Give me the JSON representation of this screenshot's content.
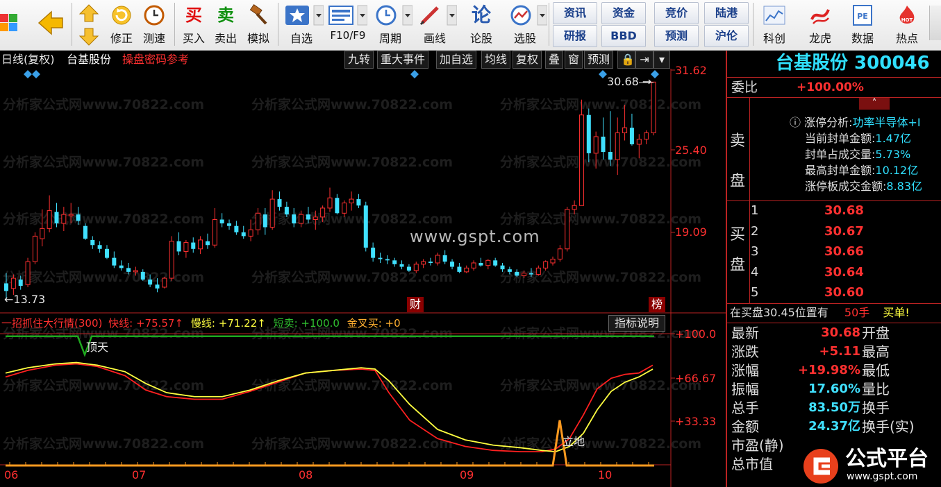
{
  "toolbar": {
    "buttons": [
      {
        "label": "修正",
        "icon": "refresh-icon"
      },
      {
        "label": "测速",
        "icon": "clock-icon"
      },
      {
        "label": "买入",
        "icon": "buy-icon"
      },
      {
        "label": "卖出",
        "icon": "sell-icon"
      },
      {
        "label": "模拟",
        "icon": "gavel-icon"
      },
      {
        "label": "自选",
        "icon": "star-icon"
      },
      {
        "label": "F10/F9",
        "icon": "f10-icon"
      },
      {
        "label": "周期",
        "icon": "period-icon"
      },
      {
        "label": "画线",
        "icon": "pen-icon"
      },
      {
        "label": "论股",
        "icon": "discuss-icon"
      },
      {
        "label": "选股",
        "icon": "select-stock-icon"
      },
      {
        "label": "科创",
        "icon": "kechuang-icon"
      },
      {
        "label": "龙虎",
        "icon": "dragon-icon"
      },
      {
        "label": "数据",
        "icon": "pe-icon"
      },
      {
        "label": "热点",
        "icon": "hot-icon"
      }
    ],
    "pairs": [
      {
        "top": "资讯",
        "bottom": "研报"
      },
      {
        "top": "资金",
        "bottom": "BBD"
      },
      {
        "top": "竞价",
        "bottom": "预测"
      },
      {
        "top": "陆港",
        "bottom": "沪伦"
      }
    ]
  },
  "chart": {
    "period_label": "日线(复权)",
    "stock_name": "台基股份",
    "alert_text": "操盘密码参考",
    "tabs": [
      "九转",
      "重大事件",
      "加自选",
      "均线",
      "复权",
      "叠",
      "窗",
      "预测"
    ],
    "price_axis": [
      "31.62",
      "25.40",
      "19.09"
    ],
    "max_label": "30.68",
    "min_label": "13.73",
    "marker_cai": "财",
    "marker_bang": "榜",
    "watermark": "分析家公式网www.70822.com",
    "center_watermark": "www.gspt.com",
    "months": [
      "06",
      "07",
      "08",
      "09",
      "10"
    ]
  },
  "indicator": {
    "name": "一招抓住大行情(300)",
    "fast_label": "快线:",
    "fast_value": "+75.57↑",
    "slow_label": "慢线:",
    "slow_value": "+71.22↑",
    "short_label": "短卖:",
    "short_value": "+100.0",
    "cross_label": "金叉买:",
    "cross_value": "+0",
    "explain_button": "指标说明",
    "axis": [
      "+100.0",
      "+66.67",
      "+33.33"
    ],
    "top_label": "顶天",
    "bottom_label": "立地",
    "fast_color": "#ff2020",
    "slow_color": "#ffff40"
  },
  "quote": {
    "title": "台基股份 300046",
    "weibi_label": "委比",
    "weibi_value": "+100.00%",
    "sell_label": [
      "卖",
      "盘"
    ],
    "limit_title": "涨停分析:",
    "limit_sector": "功率半导体+I",
    "limit_lines": [
      {
        "label": "当前封单金额:",
        "value": "1.47亿"
      },
      {
        "label": "封单占成交量:",
        "value": "5.73%"
      },
      {
        "label": "最高封单金额:",
        "value": "10.12亿"
      },
      {
        "label": "涨停板成交金额:",
        "value": "8.83亿"
      }
    ],
    "buy_label": [
      "买",
      "盘"
    ],
    "bids": [
      {
        "level": "1",
        "price": "30.68"
      },
      {
        "level": "2",
        "price": "30.67"
      },
      {
        "level": "3",
        "price": "30.66"
      },
      {
        "level": "4",
        "price": "30.64"
      },
      {
        "level": "5",
        "price": "30.60"
      }
    ],
    "alert_prefix": "在买盘30.45位置有",
    "alert_qty": "50手",
    "alert_suffix": "买单!",
    "stats": [
      {
        "label": "最新",
        "value": "30.68",
        "label2": "开盘",
        "color": "#ff3030"
      },
      {
        "label": "涨跌",
        "value": "+5.11",
        "label2": "最高",
        "color": "#ff3030"
      },
      {
        "label": "涨幅",
        "value": "+19.98%",
        "label2": "最低",
        "color": "#ff3030"
      },
      {
        "label": "振幅",
        "value": "17.60%",
        "label2": "量比",
        "color": "#40e0ff"
      },
      {
        "label": "总手",
        "value": "83.50万",
        "label2": "换手",
        "color": "#40e0ff"
      },
      {
        "label": "金额",
        "value": "24.37亿",
        "label2": "换手(实)",
        "color": "#40e0ff"
      },
      {
        "label": "市盈(静)",
        "value": "",
        "label2": "",
        "color": "#40e0ff"
      },
      {
        "label": "总市值",
        "value": "",
        "label2": "",
        "color": "#40e0ff"
      }
    ],
    "logo_text": "公式平台",
    "logo_url": "www.gspt.com"
  },
  "candles": [
    [
      14.9,
      15.7,
      13.73,
      14.3
    ],
    [
      14.5,
      15.6,
      14.0,
      15.3
    ],
    [
      15.2,
      15.5,
      14.4,
      14.7
    ],
    [
      14.8,
      16.9,
      14.6,
      16.6
    ],
    [
      16.6,
      18.9,
      16.4,
      18.6
    ],
    [
      18.4,
      20.7,
      17.8,
      19.2
    ],
    [
      19.2,
      21.8,
      18.9,
      20.6
    ],
    [
      20.5,
      21.2,
      19.3,
      19.6
    ],
    [
      19.6,
      20.9,
      19.0,
      20.3
    ],
    [
      20.2,
      21.2,
      19.6,
      20.3
    ],
    [
      20.3,
      20.9,
      19.5,
      19.8
    ],
    [
      19.4,
      19.6,
      18.3,
      18.4
    ],
    [
      18.3,
      18.6,
      17.6,
      17.9
    ],
    [
      17.9,
      18.2,
      17.3,
      17.6
    ],
    [
      17.6,
      17.9,
      16.8,
      16.9
    ],
    [
      16.9,
      17.4,
      16.1,
      16.3
    ],
    [
      16.3,
      16.7,
      15.9,
      16.1
    ],
    [
      16.1,
      16.5,
      15.6,
      15.8
    ],
    [
      15.8,
      16.2,
      15.5,
      15.9
    ],
    [
      15.8,
      16.0,
      15.1,
      15.2
    ],
    [
      15.2,
      15.6,
      14.6,
      14.8
    ],
    [
      14.8,
      15.3,
      14.2,
      14.5
    ],
    [
      14.6,
      15.4,
      14.5,
      15.3
    ],
    [
      15.3,
      18.6,
      15.1,
      18.2
    ],
    [
      18.2,
      18.9,
      17.1,
      17.4
    ],
    [
      17.4,
      18.3,
      16.9,
      18.1
    ],
    [
      18.1,
      18.5,
      17.3,
      17.6
    ],
    [
      17.6,
      18.6,
      17.2,
      18.3
    ],
    [
      18.2,
      18.8,
      17.6,
      17.9
    ],
    [
      17.9,
      20.8,
      17.7,
      19.9
    ],
    [
      19.9,
      20.4,
      19.3,
      19.6
    ],
    [
      19.6,
      19.9,
      19.1,
      19.4
    ],
    [
      19.4,
      19.8,
      18.7,
      18.9
    ],
    [
      18.9,
      19.4,
      18.4,
      18.6
    ],
    [
      18.6,
      19.9,
      18.2,
      19.1
    ],
    [
      19.1,
      20.8,
      18.7,
      20.4
    ],
    [
      20.3,
      20.8,
      18.7,
      19.3
    ],
    [
      19.3,
      22.2,
      19.1,
      21.5
    ],
    [
      21.5,
      22.1,
      20.6,
      20.9
    ],
    [
      20.9,
      21.3,
      20.1,
      20.3
    ],
    [
      20.3,
      20.8,
      19.3,
      19.6
    ],
    [
      19.6,
      20.6,
      19.3,
      20.3
    ],
    [
      20.3,
      20.9,
      19.6,
      19.9
    ],
    [
      19.9,
      20.6,
      19.1,
      20.1
    ],
    [
      20.1,
      21.0,
      19.7,
      20.8
    ],
    [
      20.8,
      22.4,
      20.5,
      21.6
    ],
    [
      21.6,
      21.9,
      20.3,
      20.4
    ],
    [
      20.4,
      21.4,
      20.1,
      21.2
    ],
    [
      21.2,
      22.1,
      20.6,
      21.5
    ],
    [
      21.5,
      21.9,
      20.8,
      21.0
    ],
    [
      21.0,
      21.3,
      17.4,
      17.7
    ],
    [
      17.7,
      18.1,
      16.6,
      16.9
    ],
    [
      16.9,
      17.3,
      16.5,
      16.8
    ],
    [
      16.8,
      17.1,
      16.4,
      16.7
    ],
    [
      16.7,
      16.9,
      16.2,
      16.4
    ],
    [
      16.4,
      16.7,
      16.0,
      16.2
    ],
    [
      16.2,
      16.4,
      15.8,
      15.9
    ],
    [
      15.9,
      16.6,
      15.7,
      16.4
    ],
    [
      16.4,
      16.8,
      16.1,
      16.6
    ],
    [
      16.6,
      16.9,
      16.3,
      16.5
    ],
    [
      16.5,
      17.3,
      16.3,
      17.1
    ],
    [
      17.1,
      17.5,
      16.4,
      16.6
    ],
    [
      16.6,
      16.8,
      16.0,
      16.2
    ],
    [
      16.2,
      16.5,
      15.7,
      15.8
    ],
    [
      15.8,
      16.3,
      15.7,
      16.1
    ],
    [
      16.1,
      16.7,
      15.9,
      16.5
    ],
    [
      16.5,
      16.9,
      16.2,
      16.3
    ],
    [
      16.3,
      16.8,
      16.0,
      16.7
    ],
    [
      16.7,
      16.9,
      16.2,
      16.3
    ],
    [
      16.3,
      16.5,
      15.8,
      16.0
    ],
    [
      16.0,
      16.2,
      15.6,
      15.8
    ],
    [
      15.8,
      16.0,
      15.4,
      15.5
    ],
    [
      15.5,
      15.9,
      15.3,
      15.7
    ],
    [
      15.7,
      16.1,
      15.4,
      15.6
    ],
    [
      15.6,
      16.3,
      15.5,
      16.1
    ],
    [
      16.1,
      16.7,
      15.9,
      16.6
    ],
    [
      16.5,
      17.0,
      16.3,
      16.8
    ],
    [
      16.8,
      17.9,
      16.6,
      17.6
    ],
    [
      17.6,
      20.9,
      17.4,
      20.7
    ],
    [
      20.7,
      21.4,
      20.3,
      21.0
    ],
    [
      21.0,
      29.3,
      22.6,
      28.1
    ],
    [
      28.1,
      28.6,
      24.4,
      25.1
    ],
    [
      25.1,
      26.8,
      23.9,
      26.4
    ],
    [
      26.4,
      27.9,
      24.6,
      25.2
    ],
    [
      25.2,
      28.4,
      24.1,
      24.6
    ],
    [
      24.6,
      27.9,
      23.4,
      26.7
    ],
    [
      26.7,
      28.9,
      26.1,
      27.1
    ],
    [
      27.1,
      28.2,
      25.7,
      25.8
    ],
    [
      25.8,
      26.6,
      24.7,
      26.2
    ],
    [
      26.2,
      26.9,
      25.8,
      26.7
    ],
    [
      26.7,
      30.68,
      26.5,
      30.68
    ]
  ]
}
